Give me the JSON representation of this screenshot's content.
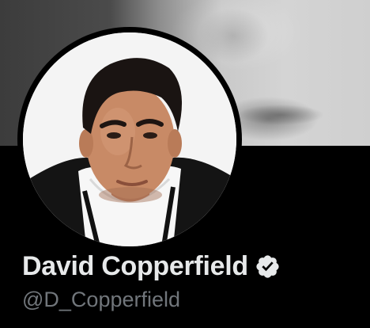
{
  "profile": {
    "display_name": "David Copperfield",
    "handle": "@D_Copperfield",
    "verified": true
  },
  "icons": {
    "verified": "verified-badge-icon"
  },
  "colors": {
    "background": "#000000",
    "name_text": "#e7e9ea",
    "handle_text": "#71767b",
    "badge": "#e7e9ea"
  }
}
